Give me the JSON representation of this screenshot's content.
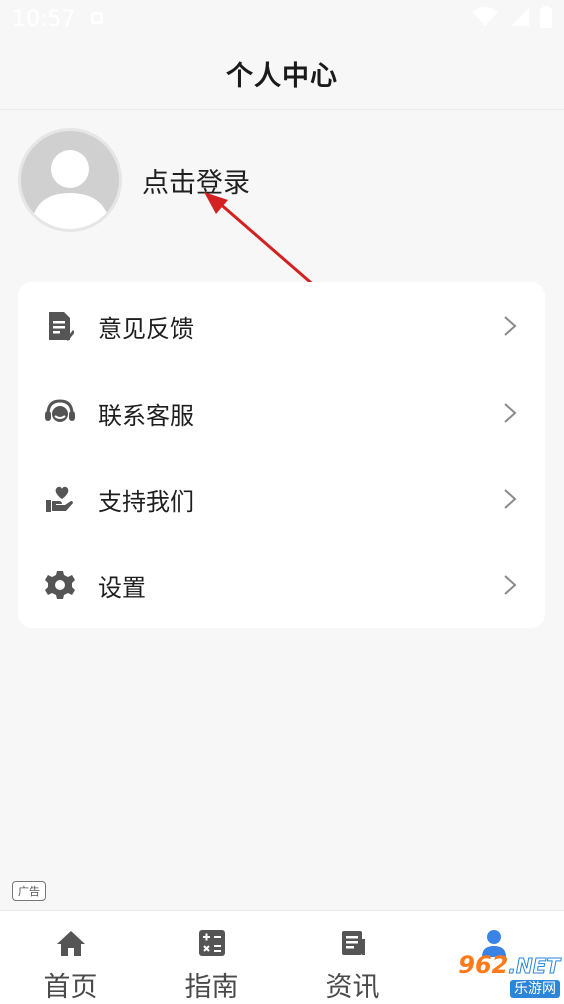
{
  "status_bar": {
    "time": "10:57"
  },
  "header": {
    "title": "个人中心"
  },
  "profile": {
    "login_label": "点击登录"
  },
  "menu": {
    "items": [
      {
        "label": "意见反馈",
        "icon": "feedback-icon"
      },
      {
        "label": "联系客服",
        "icon": "headset-icon"
      },
      {
        "label": "支持我们",
        "icon": "heart-hand-icon"
      },
      {
        "label": "设置",
        "icon": "gear-icon"
      }
    ]
  },
  "ad": {
    "label": "广告"
  },
  "tabs": [
    {
      "label": "首页",
      "icon": "home-icon",
      "active": false
    },
    {
      "label": "指南",
      "icon": "calculator-icon",
      "active": false
    },
    {
      "label": "资讯",
      "icon": "news-icon",
      "active": false
    },
    {
      "label": "",
      "icon": "user-icon",
      "active": true
    }
  ],
  "watermark": {
    "brand": "962",
    "suffix": ".NET",
    "sub": "乐游网"
  },
  "colors": {
    "accent": "#3a83e6",
    "background": "#f7f7f7",
    "card": "#ffffff",
    "arrow": "#d32121"
  }
}
